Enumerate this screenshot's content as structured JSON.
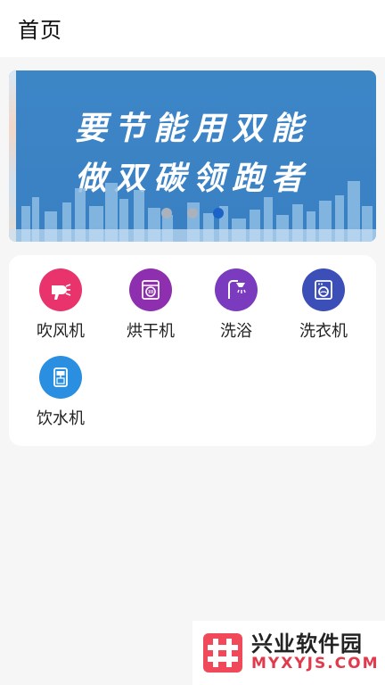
{
  "header": {
    "title": "首页"
  },
  "banner": {
    "line1": "要节能用双能",
    "line2": "做双碳领跑者",
    "dots_count": 3,
    "active_dot": 2
  },
  "devices": [
    {
      "label": "吹风机",
      "icon": "hair-dryer-icon",
      "color": "#e8336d"
    },
    {
      "label": "烘干机",
      "icon": "dryer-icon",
      "color": "#8e2fb0"
    },
    {
      "label": "洗浴",
      "icon": "shower-icon",
      "color": "#7b3bbf"
    },
    {
      "label": "洗衣机",
      "icon": "washing-machine-icon",
      "color": "#3c4fb8"
    },
    {
      "label": "饮水机",
      "icon": "water-dispenser-icon",
      "color": "#2a8fe0"
    }
  ],
  "watermark": {
    "title": "兴业软件园",
    "url": "MYXYJS.COM"
  }
}
